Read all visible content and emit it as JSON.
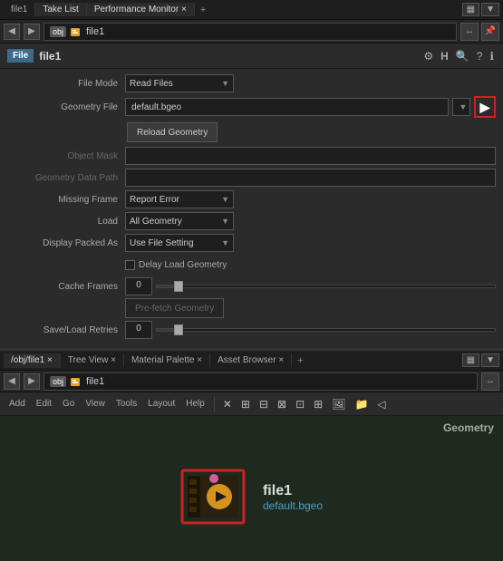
{
  "tabs_top": {
    "items": [
      {
        "label": "file1",
        "active": false
      },
      {
        "label": "Take List",
        "active": false
      },
      {
        "label": "Performance Monitor",
        "active": true
      }
    ],
    "plus": "+"
  },
  "address_bar": {
    "back": "◀",
    "forward": "▶",
    "obj_label": "obj",
    "file_label": "file1",
    "right_btn": "↔"
  },
  "header": {
    "file_badge": "File",
    "title": "file1",
    "icons": [
      "⚙",
      "H",
      "🔍",
      "?",
      "ℹ"
    ]
  },
  "form": {
    "file_mode_label": "File Mode",
    "file_mode_value": "Read Files",
    "geometry_file_label": "Geometry File",
    "geometry_file_value": "default.bgeo",
    "reload_btn": "Reload Geometry",
    "object_mask_label": "Object Mask",
    "geometry_data_path_label": "Geometry Data Path",
    "missing_frame_label": "Missing Frame",
    "missing_frame_value": "Report Error",
    "load_label": "Load",
    "load_value": "All Geometry",
    "display_packed_label": "Display Packed As",
    "display_packed_value": "Use File Setting",
    "delay_load_label": "Delay Load Geometry",
    "cache_frames_label": "Cache Frames",
    "cache_frames_value": "0",
    "prefetch_btn": "Pre-fetch Geometry",
    "save_load_label": "Save/Load Retries",
    "save_load_value": "0"
  },
  "tabs_bottom": {
    "items": [
      {
        "label": "/obj/file1",
        "active": true
      },
      {
        "label": "Tree View",
        "active": false
      },
      {
        "label": "Material Palette",
        "active": false
      },
      {
        "label": "Asset Browser",
        "active": false
      }
    ],
    "plus": "+"
  },
  "toolbar_bottom": {
    "items": [
      "Add",
      "Edit",
      "Go",
      "View",
      "Tools",
      "Layout",
      "Help"
    ]
  },
  "viewport": {
    "label": "Geometry",
    "geo_name": "file1",
    "geo_path": "default.bgeo"
  }
}
